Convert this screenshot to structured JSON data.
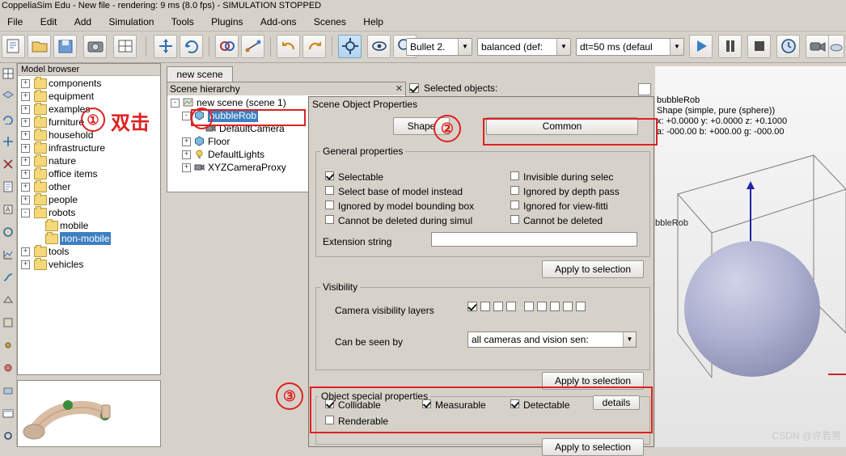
{
  "titlebar": {
    "text": "CoppeliaSim Edu - New file - rendering: 9 ms (8.0 fps) - SIMULATION STOPPED"
  },
  "menubar": {
    "items": [
      "File",
      "Edit",
      "Add",
      "Simulation",
      "Tools",
      "Plugins",
      "Add-ons",
      "Scenes",
      "Help"
    ]
  },
  "toolbar": {
    "engine_combo": "Bullet 2.",
    "accuracy_combo": "balanced (def:",
    "dt_combo": "dt=50 ms (defaul",
    "icons": [
      "new-scene-icon",
      "open-file-icon",
      "save-file-icon",
      "camera-icon",
      "page-selector-icon",
      "object-shift-icon",
      "object-rotate-icon",
      "collision-icon",
      "distance-icon",
      "undo-icon",
      "redo-icon",
      "dynamic-content-icon",
      "visibility-layers-icon",
      "settings-icon",
      "play-icon",
      "pause-icon",
      "stop-icon",
      "clock-icon",
      "video-recorder-icon",
      "cloud-icon"
    ]
  },
  "model_browser": {
    "title": "Model browser",
    "items": [
      {
        "label": "components",
        "indent": 0,
        "expand": "+",
        "folder": true
      },
      {
        "label": "equipment",
        "indent": 0,
        "expand": "+",
        "folder": true
      },
      {
        "label": "examples",
        "indent": 0,
        "expand": "+",
        "folder": true
      },
      {
        "label": "furniture",
        "indent": 0,
        "expand": "+",
        "folder": true
      },
      {
        "label": "household",
        "indent": 0,
        "expand": "+",
        "folder": true
      },
      {
        "label": "infrastructure",
        "indent": 0,
        "expand": "+",
        "folder": true
      },
      {
        "label": "nature",
        "indent": 0,
        "expand": "+",
        "folder": true
      },
      {
        "label": "office items",
        "indent": 0,
        "expand": "+",
        "folder": true
      },
      {
        "label": "other",
        "indent": 0,
        "expand": "+",
        "folder": true
      },
      {
        "label": "people",
        "indent": 0,
        "expand": "+",
        "folder": true
      },
      {
        "label": "robots",
        "indent": 0,
        "expand": "-",
        "folder": true
      },
      {
        "label": "mobile",
        "indent": 1,
        "expand": "",
        "folder": true
      },
      {
        "label": "non-mobile",
        "indent": 1,
        "expand": "",
        "folder": true,
        "selected": true
      },
      {
        "label": "tools",
        "indent": 0,
        "expand": "+",
        "folder": true
      },
      {
        "label": "vehicles",
        "indent": 0,
        "expand": "+",
        "folder": true
      }
    ]
  },
  "scene_tab": {
    "label": "new scene"
  },
  "hierarchy": {
    "title": "Scene hierarchy",
    "close_label": "✕",
    "items": [
      {
        "label": "new scene (scene 1)",
        "indent": 0,
        "expand": "-",
        "icon": "scene-icon"
      },
      {
        "label": "bubbleRob",
        "indent": 1,
        "expand": "-",
        "icon": "shape-icon",
        "selected": true
      },
      {
        "label": "DefaultCamera",
        "indent": 2,
        "expand": "",
        "icon": "camera-icon"
      },
      {
        "label": "Floor",
        "indent": 1,
        "expand": "+",
        "icon": "shape-icon"
      },
      {
        "label": "DefaultLights",
        "indent": 1,
        "expand": "+",
        "icon": "light-icon"
      },
      {
        "label": "XYZCameraProxy",
        "indent": 1,
        "expand": "+",
        "icon": "camera-icon"
      }
    ]
  },
  "selected_objects": {
    "label": "Selected objects:"
  },
  "properties": {
    "title": "Scene Object Properties",
    "shape_button": "Shape",
    "common_button": "Common",
    "general_group": "General properties",
    "general_left": [
      {
        "label": "Selectable",
        "checked": true
      },
      {
        "label": "Select base of model instead",
        "checked": false
      },
      {
        "label": "Ignored by model bounding  box",
        "checked": false
      },
      {
        "label": "Cannot be deleted during simul",
        "checked": false
      }
    ],
    "general_right": [
      {
        "label": "Invisible during selec",
        "checked": false
      },
      {
        "label": "Ignored by depth pass",
        "checked": false
      },
      {
        "label": "Ignored for view-fitti",
        "checked": false
      },
      {
        "label": "Cannot be deleted",
        "checked": false
      }
    ],
    "extension_label": "Extension string",
    "extension_value": "",
    "apply_button_1": "Apply to selection",
    "visibility_group": "Visibility",
    "camera_layers_label": "Camera visibility layers",
    "camera_layers": [
      true,
      false,
      false,
      false,
      false,
      false,
      false,
      false,
      false
    ],
    "can_be_seen_label": "Can be seen by",
    "can_be_seen_value": "all cameras and vision sen:",
    "apply_button_2": "Apply to selection",
    "special_group": "Object special properties",
    "special": [
      {
        "label": "Collidable",
        "checked": true
      },
      {
        "label": "Measurable",
        "checked": true
      },
      {
        "label": "Detectable",
        "checked": true
      },
      {
        "label": "Renderable",
        "checked": false
      }
    ],
    "details_button": "details",
    "apply_button_3": "Apply to selection"
  },
  "view3d": {
    "object_name": "bubbleRob",
    "object_type": "Shape (simple, pure (sphere))",
    "line3": "x: +0.0000   y: +0.0000   z: +0.1000",
    "line4": "a: -000.00   b: +000.00   g: -000.00",
    "floating_label": "bbleRob",
    "watermark": "CSDN @许若男"
  },
  "annotations": {
    "step1_number": "①",
    "step1_text": "双击",
    "step2_number": "②",
    "step3_number": "③",
    "accent_color": "#e02020"
  }
}
